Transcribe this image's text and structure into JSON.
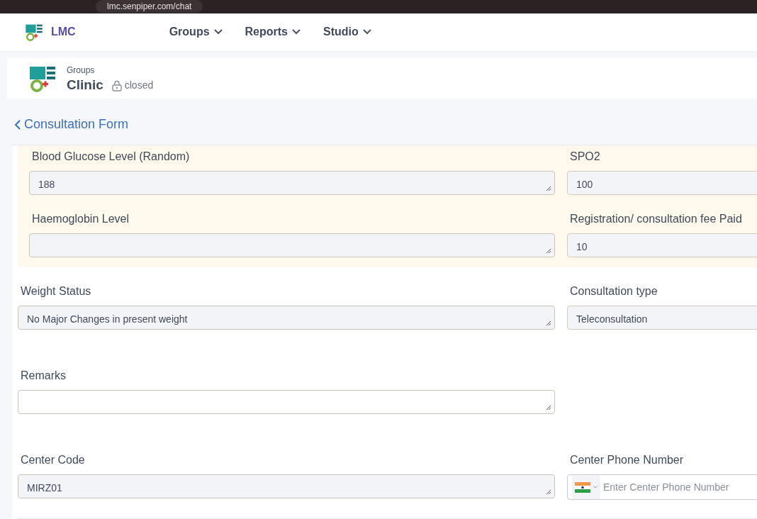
{
  "browser": {
    "url": "lmc.senpiper.com/chat"
  },
  "navbar": {
    "brand": "LMC",
    "menus": [
      {
        "label": "Groups"
      },
      {
        "label": "Reports"
      },
      {
        "label": "Studio"
      }
    ]
  },
  "group_header": {
    "breadcrumb": "Groups",
    "title": "Clinic",
    "status": "closed"
  },
  "back_link": "Consultation Form",
  "highlighted_section": {
    "rows": [
      [
        {
          "label": "Blood Glucose Level (Random)",
          "value": "188",
          "kind": "textarea",
          "editable": false
        },
        {
          "label": "SPO2",
          "value": "100",
          "kind": "input"
        }
      ],
      [
        {
          "label": "Haemoglobin Level",
          "kind": "textarea",
          "editable": false
        },
        {
          "label": "Registration/ consultation fee Paid",
          "value": "10",
          "kind": "input"
        }
      ]
    ]
  },
  "rows": [
    [
      {
        "label": "Weight Status",
        "value": "No Major Changes in present weight",
        "kind": "textarea",
        "editable": false
      },
      {
        "label": "Consultation type",
        "value": "Teleconsultation",
        "kind": "input"
      }
    ],
    [
      {
        "label": "Remarks",
        "kind": "textarea",
        "editable": true
      }
    ],
    [
      {
        "label": "Center Code",
        "value": "MIRZ01",
        "kind": "textarea",
        "editable": false
      },
      {
        "label": "Center Phone Number",
        "placeholder": "Enter Center Phone Number",
        "kind": "phone"
      }
    ]
  ]
}
